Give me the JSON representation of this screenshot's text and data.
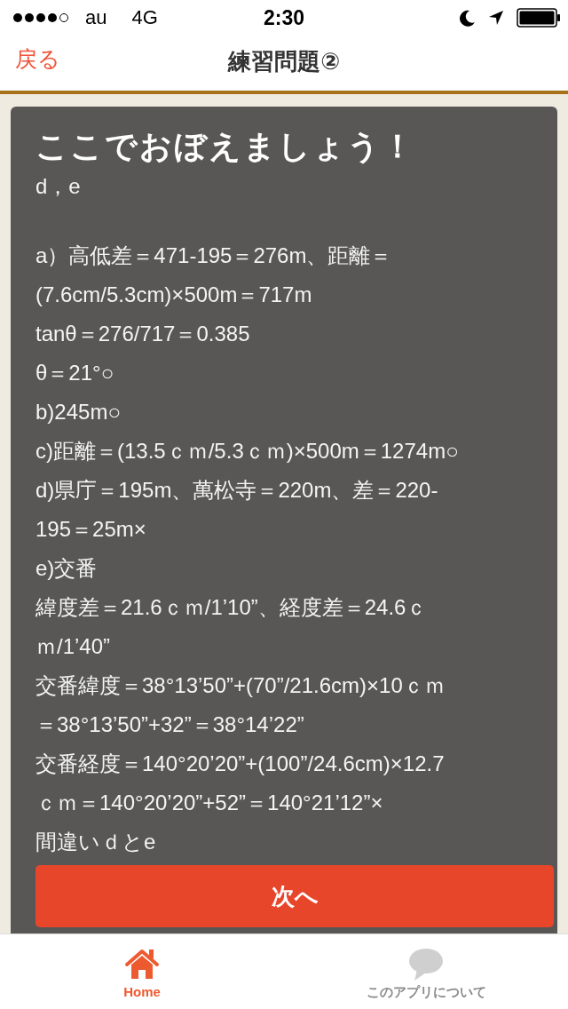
{
  "status_bar": {
    "carrier": "au",
    "network": "4G",
    "time": "2:30"
  },
  "nav_bar": {
    "back": "戻る",
    "title": "練習問題②"
  },
  "card": {
    "title": "ここでおぼえましょう！",
    "paragraphs": [
      [
        "d，e"
      ],
      [
        "a）高低差＝471-195＝276m、距離＝",
        "(7.6cm/5.3cm)×500m＝717m",
        "tanθ＝276/717＝0.385",
        "θ＝21°○",
        "b)245m○",
        "c)距離＝(13.5ｃｍ/5.3ｃｍ)×500m＝1274m○",
        "d)県庁＝195m、萬松寺＝220m、差＝220-",
        "195＝25m×",
        "e)交番",
        "緯度差＝21.6ｃｍ/1’10”、経度差＝24.6ｃ",
        "ｍ/1’40”",
        "交番緯度＝38°13’50”+(70”/21.6cm)×10ｃｍ",
        "＝38°13’50”+32”＝38°14’22”",
        "交番経度＝140°20’20”+(100”/24.6cm)×12.7",
        "ｃｍ＝140°20’20”+52”＝140°21’12”×",
        "間違いｄとe"
      ]
    ],
    "button": "次へ"
  },
  "tab_bar": [
    {
      "label": "Home",
      "kind": "home",
      "selected": true
    },
    {
      "label": "このアプリについて",
      "kind": "about",
      "selected": false
    }
  ]
}
